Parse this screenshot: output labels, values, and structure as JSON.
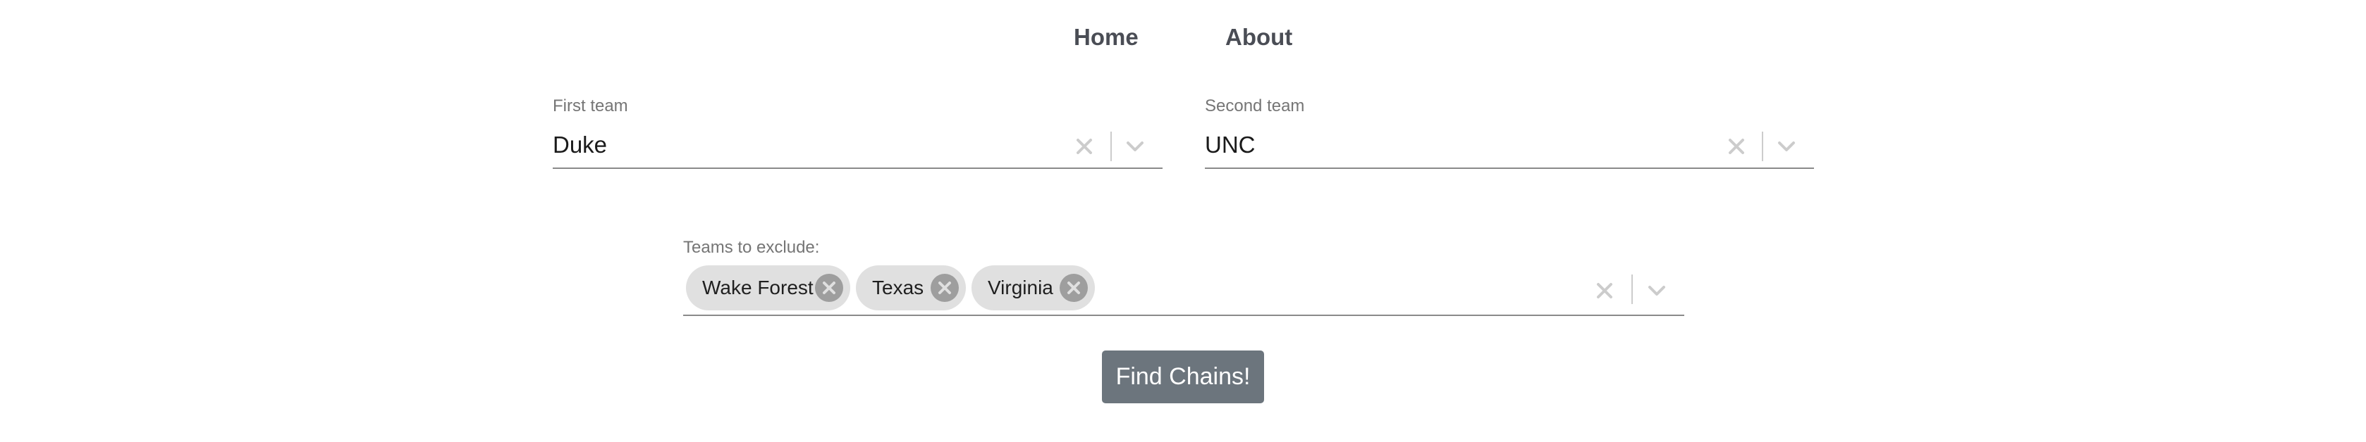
{
  "nav": {
    "home_label": "Home",
    "about_label": "About"
  },
  "first_team": {
    "label": "First team",
    "value": "Duke"
  },
  "second_team": {
    "label": "Second team",
    "value": "UNC"
  },
  "exclude": {
    "label": "Teams to exclude:",
    "chips": [
      {
        "label": "Wake Forest"
      },
      {
        "label": "Texas"
      },
      {
        "label": "Virginia"
      }
    ]
  },
  "find_button": {
    "label": "Find Chains!"
  },
  "icons": {
    "clear": "close-icon",
    "dropdown": "chevron-down-icon",
    "chip_delete": "cancel-circle-icon"
  },
  "colors": {
    "button_bg": "#6c757d",
    "chip_bg": "#e0e0e0",
    "chip_delete": "#9e9e9e",
    "indicator": "#cccccc",
    "nav_text": "#4a4d55"
  }
}
